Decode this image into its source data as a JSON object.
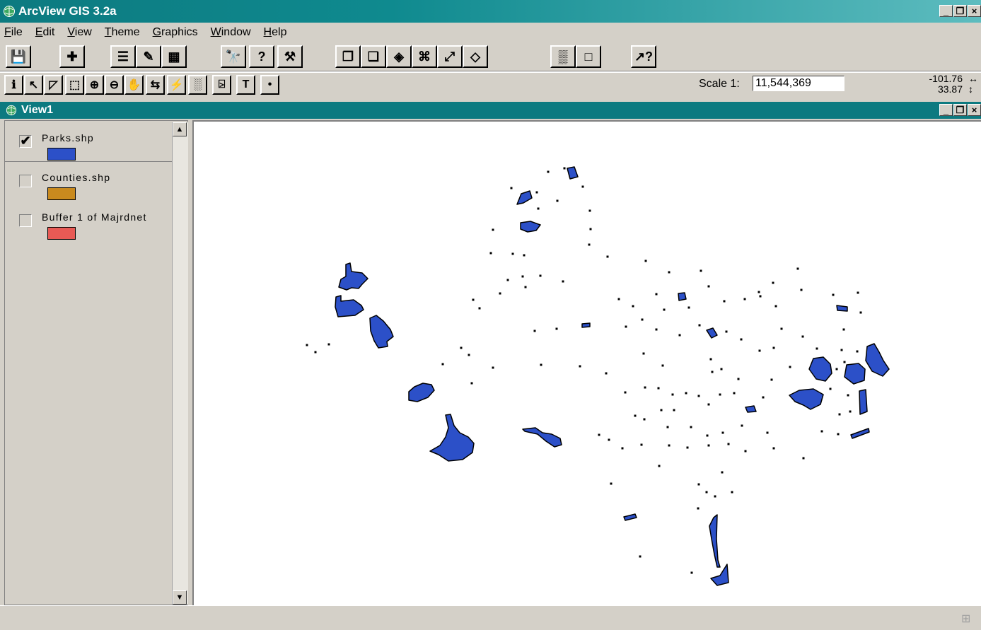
{
  "app": {
    "title": "ArcView GIS 3.2a",
    "window_buttons": [
      "_",
      "×"
    ]
  },
  "menu": [
    {
      "ul": "F",
      "rest": "ile"
    },
    {
      "ul": "E",
      "rest": "dit"
    },
    {
      "ul": "V",
      "rest": "iew"
    },
    {
      "ul": "T",
      "rest": "heme"
    },
    {
      "ul": "G",
      "rest": "raphics"
    },
    {
      "ul": "W",
      "rest": "indow"
    },
    {
      "ul": "H",
      "rest": "elp"
    }
  ],
  "toolbar1": [
    {
      "name": "save-button",
      "glyph": "💾",
      "icon": "floppy-disk-icon"
    },
    {
      "name": "add-theme-button",
      "glyph": "✚",
      "icon": "add-theme-icon"
    },
    {
      "name": "theme-properties-button",
      "glyph": "☰",
      "icon": "properties-icon"
    },
    {
      "name": "edit-legend-button",
      "glyph": "✎",
      "icon": "legend-editor-icon"
    },
    {
      "name": "open-table-button",
      "glyph": "▦",
      "icon": "table-icon"
    },
    {
      "name": "find-button",
      "glyph": "🔭",
      "icon": "binoculars-icon"
    },
    {
      "name": "locate-address-button",
      "glyph": "?",
      "icon": "locate-icon"
    },
    {
      "name": "query-builder-button",
      "glyph": "⚒",
      "icon": "hammer-icon"
    },
    {
      "name": "zoom-full-extent-button",
      "glyph": "❐",
      "icon": "layers-icon"
    },
    {
      "name": "zoom-active-themes-button",
      "glyph": "❑",
      "icon": "layers-active-icon"
    },
    {
      "name": "zoom-selected-button",
      "glyph": "◈",
      "icon": "zoom-selected-icon"
    },
    {
      "name": "zoom-in-fixed-button",
      "glyph": "⌘",
      "icon": "zoom-in-fixed-icon"
    },
    {
      "name": "zoom-out-fixed-button",
      "glyph": "⤢",
      "icon": "zoom-out-fixed-icon"
    },
    {
      "name": "zoom-previous-button",
      "glyph": "◇",
      "icon": "zoom-previous-icon"
    },
    {
      "name": "select-by-theme-button",
      "glyph": "▒",
      "icon": "select-theme-icon"
    },
    {
      "name": "clear-selected-button",
      "glyph": "□",
      "icon": "clear-selection-icon"
    },
    {
      "name": "help-button",
      "glyph": "↗?",
      "icon": "help-pointer-icon"
    }
  ],
  "toolbar2": [
    {
      "name": "identify-tool",
      "glyph": "ℹ",
      "icon": "info-icon"
    },
    {
      "name": "pointer-tool",
      "glyph": "↖",
      "icon": "pointer-icon"
    },
    {
      "name": "vertex-edit-tool",
      "glyph": "◸",
      "icon": "vertex-edit-icon"
    },
    {
      "name": "select-feature-tool",
      "glyph": "⬚",
      "icon": "select-feature-icon"
    },
    {
      "name": "zoom-in-tool",
      "glyph": "⊕",
      "icon": "zoom-in-icon"
    },
    {
      "name": "zoom-out-tool",
      "glyph": "⊖",
      "icon": "zoom-out-icon"
    },
    {
      "name": "pan-tool",
      "glyph": "✋",
      "icon": "hand-icon"
    },
    {
      "name": "measure-tool",
      "glyph": "⇆",
      "icon": "measure-icon"
    },
    {
      "name": "hot-link-tool",
      "glyph": "⚡",
      "icon": "hotlink-icon"
    },
    {
      "name": "area-of-interest-tool",
      "glyph": "░",
      "icon": "area-of-interest-icon"
    },
    {
      "name": "label-tool",
      "glyph": "⍄",
      "icon": "label-icon"
    },
    {
      "name": "text-tool",
      "glyph": "T",
      "icon": "text-icon"
    },
    {
      "name": "draw-point-tool",
      "glyph": "•",
      "icon": "point-icon"
    }
  ],
  "scale": {
    "label": "Scale 1:",
    "value": "11,544,369"
  },
  "coords": {
    "x": "-101.76",
    "y": "33.87"
  },
  "view": {
    "title": "View1"
  },
  "layers": [
    {
      "name": "Parks.shp",
      "checked": true,
      "color": "#2c50c8"
    },
    {
      "name": "Counties.shp",
      "checked": false,
      "color": "#c98a1e"
    },
    {
      "name": "Buffer 1 of Majrdnet",
      "checked": false,
      "color": "#e85a55"
    }
  ],
  "colors": {
    "park_fill": "#2c50c8",
    "park_stroke": "#000000",
    "title_teal": "#0c7a80"
  }
}
